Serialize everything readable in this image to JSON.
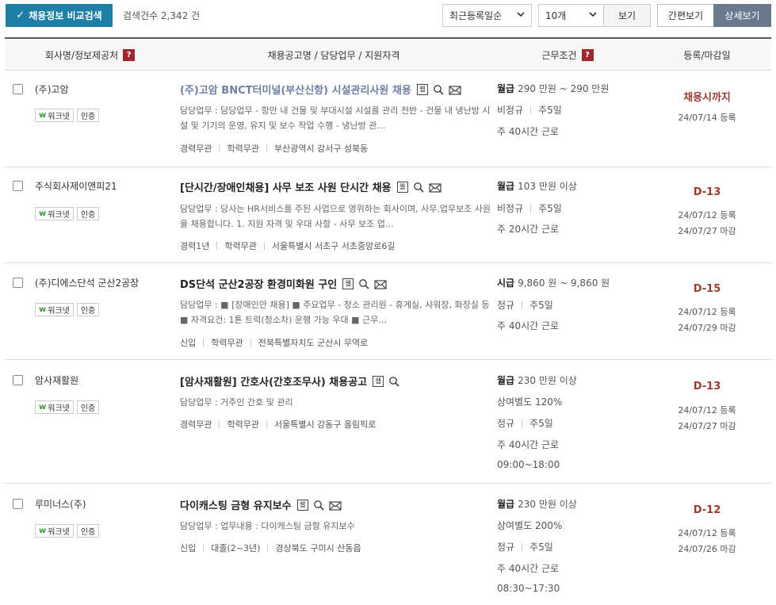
{
  "toolbar": {
    "compare_label": "채용정보 비교검색",
    "count_text": "검색건수 2,342 건",
    "sort_value": "최근등록일순",
    "per_page_value": "10개",
    "view_label": "보기",
    "simple_label": "간편보기",
    "detail_label": "상세보기"
  },
  "header": {
    "company": "회사명/정보제공처",
    "title": "채용공고명 / 담당업무 / 지원자격",
    "conditions": "근무조건",
    "date": "등록/마감일",
    "help": "?"
  },
  "badges": {
    "worknet": "워크넷",
    "cert": "인증",
    "worknet_mark": "w",
    "web_mark": "웹"
  },
  "colors": {
    "primary": "#1d7fa6",
    "help": "#a0252c",
    "dday": "#9b3a2f",
    "detail_active": "#6a7a8e"
  },
  "rows": [
    {
      "company": "(주)고암",
      "title": "(주)고암 BNCT터미널(부산신항) 시설관리사원 채용",
      "duty": "담당업무 : 담당업무 - 항만 내 건물 및 부대시설 시설를 관리 전반 - 건물 내 냉난방 시설 및 기기의 운영, 유지 및 보수 작업 수행 - 냉난방 관…",
      "meta": [
        "경력무관",
        "학력무관",
        "부산광역시 강서구 성북동"
      ],
      "cond1_label": "월급",
      "cond1_value": "290 만원 ~ 290 만원",
      "cond2": [
        "비정규",
        "주5일"
      ],
      "cond3": "주 40시간 근로",
      "dday": "채용시까지",
      "reg": "24/07/14 등록",
      "deadline": ""
    },
    {
      "company": "주식회사제이앤피21",
      "title": "[단시간/장애인채용] 사무 보조 사원 단시간 채용",
      "duty": "담당업무 : 당사는 HR서비스를 주된 사업으로 영위하는 회사이며, 사무.업무보조 사원을 채용합니다. 1. 지원 자격 및 우대 사항 - 사무 보조 업…",
      "meta": [
        "경력1년",
        "학력무관",
        "서울특별시 서초구 서초중앙로6길"
      ],
      "cond1_label": "월급",
      "cond1_value": "103 만원 이상",
      "cond2": [
        "비정규",
        "주5일"
      ],
      "cond3": "주 20시간 근로",
      "dday": "D-13",
      "reg": "24/07/12 등록",
      "deadline": "24/07/27 마감"
    },
    {
      "company": "(주)디에스단석 군산2공장",
      "title": "DS단석 군산2공장 환경미화원 구인",
      "duty": "담당업무 : ■ [장애인만 채용] ■ 주요업무 - 청소 관리원 - 휴게실, 샤워장, 화장실 등 ■ 자격요건: 1톤 트럭(청소차) 운행 가능 우대 ■ 근무…",
      "meta": [
        "신입",
        "학력무관",
        "전북특별자치도 군산시 무역로"
      ],
      "cond1_label": "시급",
      "cond1_value": "9,860 원 ~ 9,860 원",
      "cond2": [
        "정규",
        "주5일"
      ],
      "cond3": "주 40시간 근로",
      "dday": "D-15",
      "reg": "24/07/12 등록",
      "deadline": "24/07/29 마감"
    },
    {
      "company": "암사재활원",
      "title": "[암사재활원] 간호사(간호조무사) 채용공고",
      "duty": "담당업무 : 거주인 간호 및 관리",
      "meta": [
        "경력무관",
        "학력무관",
        "서울특별시 강동구 올림픽로"
      ],
      "cond1_label": "월급",
      "cond1_value": "230 만원 이상",
      "cond_extra": "상여별도 120%",
      "cond2": [
        "정규",
        "주5일"
      ],
      "cond3": "주 40시간 근로",
      "cond4": "09:00~18:00",
      "dday": "D-13",
      "reg": "24/07/12 등록",
      "deadline": "24/07/27 마감"
    },
    {
      "company": "루미너스(주)",
      "title": "다이캐스팅 금형 유지보수",
      "duty": "담당업무 : 업무내용 : 다이캐스팅 금형 유지보수",
      "meta": [
        "신입",
        "대졸(2~3년)",
        "경상북도 구미시 산동읍"
      ],
      "cond1_label": "월급",
      "cond1_value": "230 만원 이상",
      "cond_extra": "상여별도 200%",
      "cond2": [
        "정규",
        "주5일"
      ],
      "cond3": "주 40시간 근로",
      "cond4": "08:30~17:30",
      "dday": "D-12",
      "reg": "24/07/12 등록",
      "deadline": "24/07/26 마감"
    }
  ]
}
